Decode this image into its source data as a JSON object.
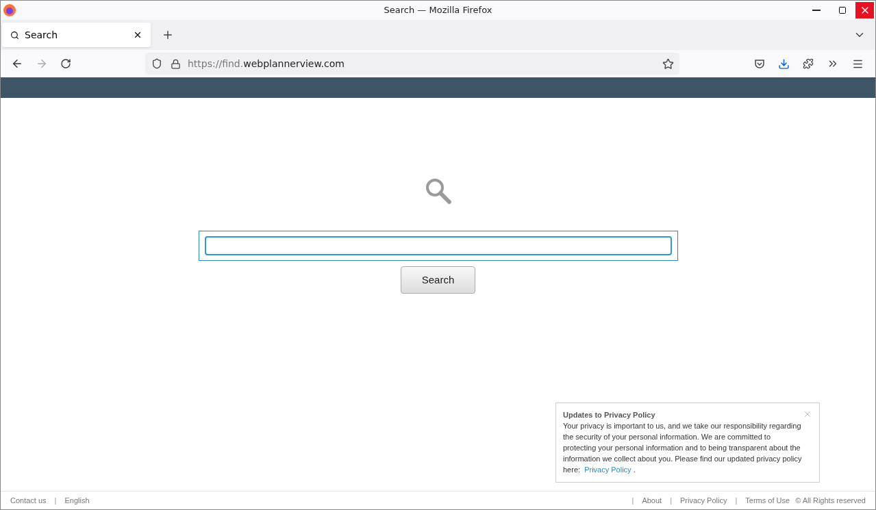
{
  "window": {
    "title": "Search — Mozilla Firefox"
  },
  "tabs": [
    {
      "label": "Search",
      "selected": true
    }
  ],
  "address_bar": {
    "url_dimmed": "https://find.",
    "url_main": "webplannerview.com"
  },
  "search": {
    "button": "Search"
  },
  "popup": {
    "title": "Updates to Privacy Policy",
    "body": "Your privacy is important to us, and we take our responsibility regarding the security of your personal information. We are committed to protecting your personal information and to being transparent about the information we collect about you. Please find our updated privacy policy here:",
    "link": "Privacy Policy",
    "after": "."
  },
  "footer": {
    "left": [
      {
        "kind": "link",
        "text": "Contact us"
      },
      {
        "kind": "separator",
        "text": "|"
      },
      {
        "kind": "link",
        "text": "English"
      }
    ],
    "right": [
      {
        "kind": "separator",
        "text": "|"
      },
      {
        "kind": "link",
        "text": "About"
      },
      {
        "kind": "separator",
        "text": "|"
      },
      {
        "kind": "link",
        "text": "Privacy Policy"
      },
      {
        "kind": "separator",
        "text": "|"
      },
      {
        "kind": "link",
        "text": "Terms of Use"
      },
      {
        "kind": "text",
        "text": "© All Rights reserved"
      }
    ]
  }
}
